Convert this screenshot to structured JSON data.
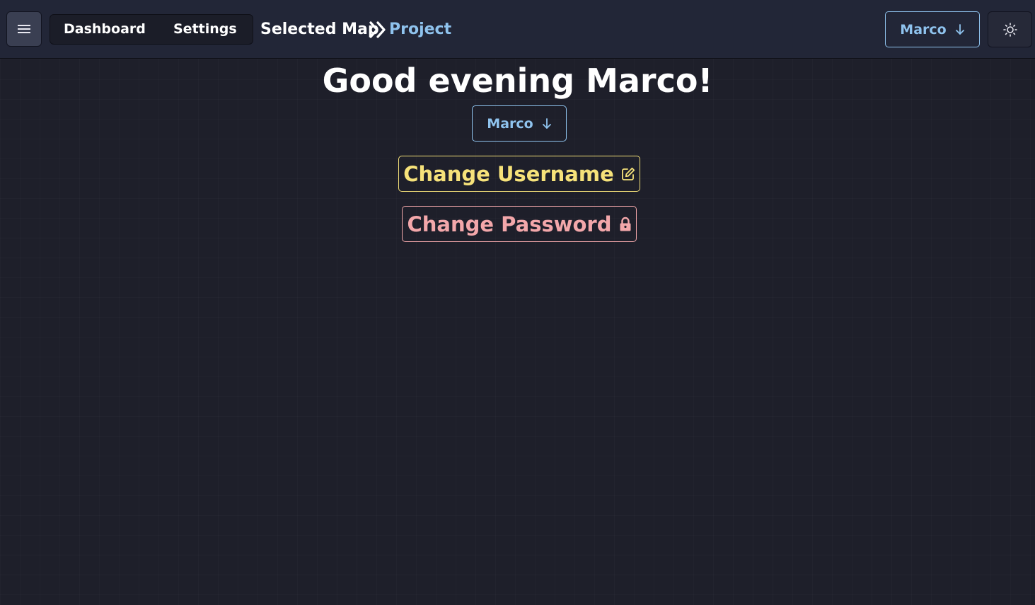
{
  "nav": {
    "dashboard_label": "Dashboard",
    "settings_label": "Settings"
  },
  "breadcrumb": {
    "current_map": "Selected Map",
    "project": "Project"
  },
  "user_menu": {
    "label": "Marco"
  },
  "main": {
    "greeting": "Good evening Marco!",
    "profile_select_label": "Marco",
    "change_username_label": "Change Username",
    "change_password_label": "Change Password"
  },
  "colors": {
    "background": "#1e1f2a",
    "topbar": "#222637",
    "accent_blue": "#8fc3ee",
    "accent_yellow": "#f6e27a",
    "accent_pink": "#f3a7aa"
  },
  "icons": {
    "menu": "hamburger-icon",
    "breadcrumb_separator": "double-chevron-right-icon",
    "dropdown": "arrow-down-icon",
    "theme": "sun-icon",
    "edit": "edit-icon",
    "lock": "lock-icon"
  }
}
